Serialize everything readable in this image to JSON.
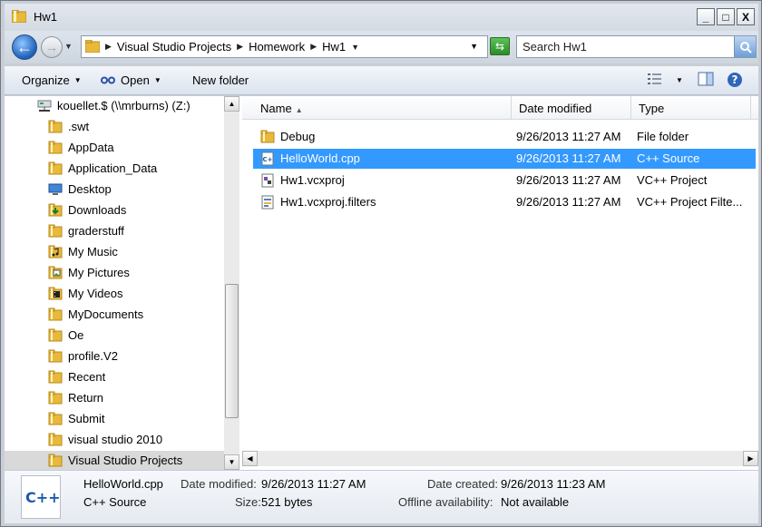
{
  "window": {
    "title": "Hw1"
  },
  "caption_buttons": {
    "minimize": "_",
    "maximize": "□",
    "close": "X"
  },
  "address": {
    "crumbs": [
      "Visual Studio Projects",
      "Homework",
      "Hw1"
    ],
    "search_placeholder": "Search Hw1"
  },
  "toolbar": {
    "organize": "Organize",
    "open": "Open",
    "new_folder": "New folder"
  },
  "sidebar": {
    "root": "kouellet.$ (\\\\mrburns) (Z:)",
    "items": [
      {
        "label": ".swt",
        "icon": "folder-icon"
      },
      {
        "label": "AppData",
        "icon": "folder-icon"
      },
      {
        "label": "Application_Data",
        "icon": "folder-icon"
      },
      {
        "label": "Desktop",
        "icon": "desktop-icon"
      },
      {
        "label": "Downloads",
        "icon": "downloads-icon"
      },
      {
        "label": "graderstuff",
        "icon": "folder-icon"
      },
      {
        "label": "My Music",
        "icon": "music-icon"
      },
      {
        "label": "My Pictures",
        "icon": "pictures-icon"
      },
      {
        "label": "My Videos",
        "icon": "videos-icon"
      },
      {
        "label": "MyDocuments",
        "icon": "folder-icon"
      },
      {
        "label": "Oe",
        "icon": "folder-icon"
      },
      {
        "label": "profile.V2",
        "icon": "folder-icon"
      },
      {
        "label": "Recent",
        "icon": "folder-icon"
      },
      {
        "label": "Return",
        "icon": "folder-icon"
      },
      {
        "label": "Submit",
        "icon": "folder-icon"
      },
      {
        "label": "visual studio 2010",
        "icon": "folder-icon"
      },
      {
        "label": "Visual Studio Projects",
        "icon": "folder-icon",
        "selected": true
      }
    ]
  },
  "columns": {
    "name": "Name",
    "date": "Date modified",
    "type": "Type"
  },
  "files": [
    {
      "name": "Debug",
      "date": "9/26/2013 11:27 AM",
      "type": "File folder",
      "icon": "folder-icon"
    },
    {
      "name": "HelloWorld.cpp",
      "date": "9/26/2013 11:27 AM",
      "type": "C++ Source",
      "icon": "cpp-file-icon",
      "selected": true
    },
    {
      "name": "Hw1.vcxproj",
      "date": "9/26/2013 11:27 AM",
      "type": "VC++ Project",
      "icon": "vcxproj-icon"
    },
    {
      "name": "Hw1.vcxproj.filters",
      "date": "9/26/2013 11:27 AM",
      "type": "VC++ Project Filte...",
      "icon": "filters-icon"
    }
  ],
  "details": {
    "icon_text": "C++",
    "name": "HelloWorld.cpp",
    "type": "C++ Source",
    "date_modified_label": "Date modified:",
    "date_modified": "9/26/2013 11:27 AM",
    "size_label": "Size:",
    "size": "521 bytes",
    "date_created_label": "Date created:",
    "date_created": "9/26/2013 11:23 AM",
    "offline_label": "Offline availability:",
    "offline": "Not available"
  },
  "colors": {
    "selection": "#3399ff",
    "folder": "#e8b93a"
  }
}
